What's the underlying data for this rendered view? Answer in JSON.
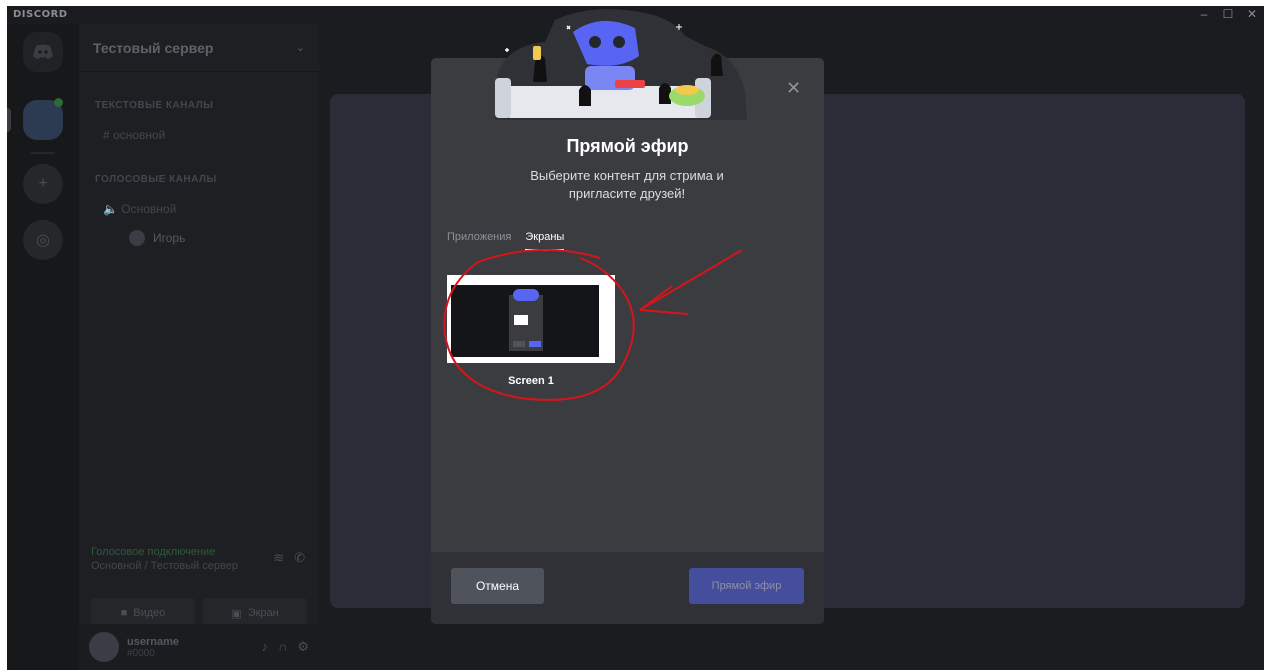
{
  "app": {
    "brand": "DISCORD",
    "window_controls": [
      "–",
      "☐",
      "✕"
    ]
  },
  "sidebar": {
    "server_name": "Тестовый сервер",
    "categories": [
      "Текстовые каналы",
      "Голосовые каналы"
    ],
    "text_channels": [
      "основной"
    ],
    "voice_channels": [
      "Основной"
    ],
    "voice_user": "Игорь"
  },
  "rtc": {
    "status": "Голосовое подключение",
    "channel": "Основной / Тестовый сервер",
    "video_label": "Видео",
    "screen_label": "Экран"
  },
  "user": {
    "name": "username",
    "tag": "#0000"
  },
  "modal": {
    "title": "Прямой эфир",
    "subtitle": "Выберите контент для стрима и пригласите друзей!",
    "tabs": [
      {
        "label": "Приложения",
        "active": false
      },
      {
        "label": "Экраны",
        "active": true
      }
    ],
    "screen_caption": "Screen 1",
    "cancel_label": "Отмена",
    "golive_label": "Прямой эфир"
  },
  "colors": {
    "accent": "#5865f2",
    "annotation": "#d8141b"
  },
  "icons": {
    "close": "close-icon",
    "home": "discord-logo-icon"
  }
}
